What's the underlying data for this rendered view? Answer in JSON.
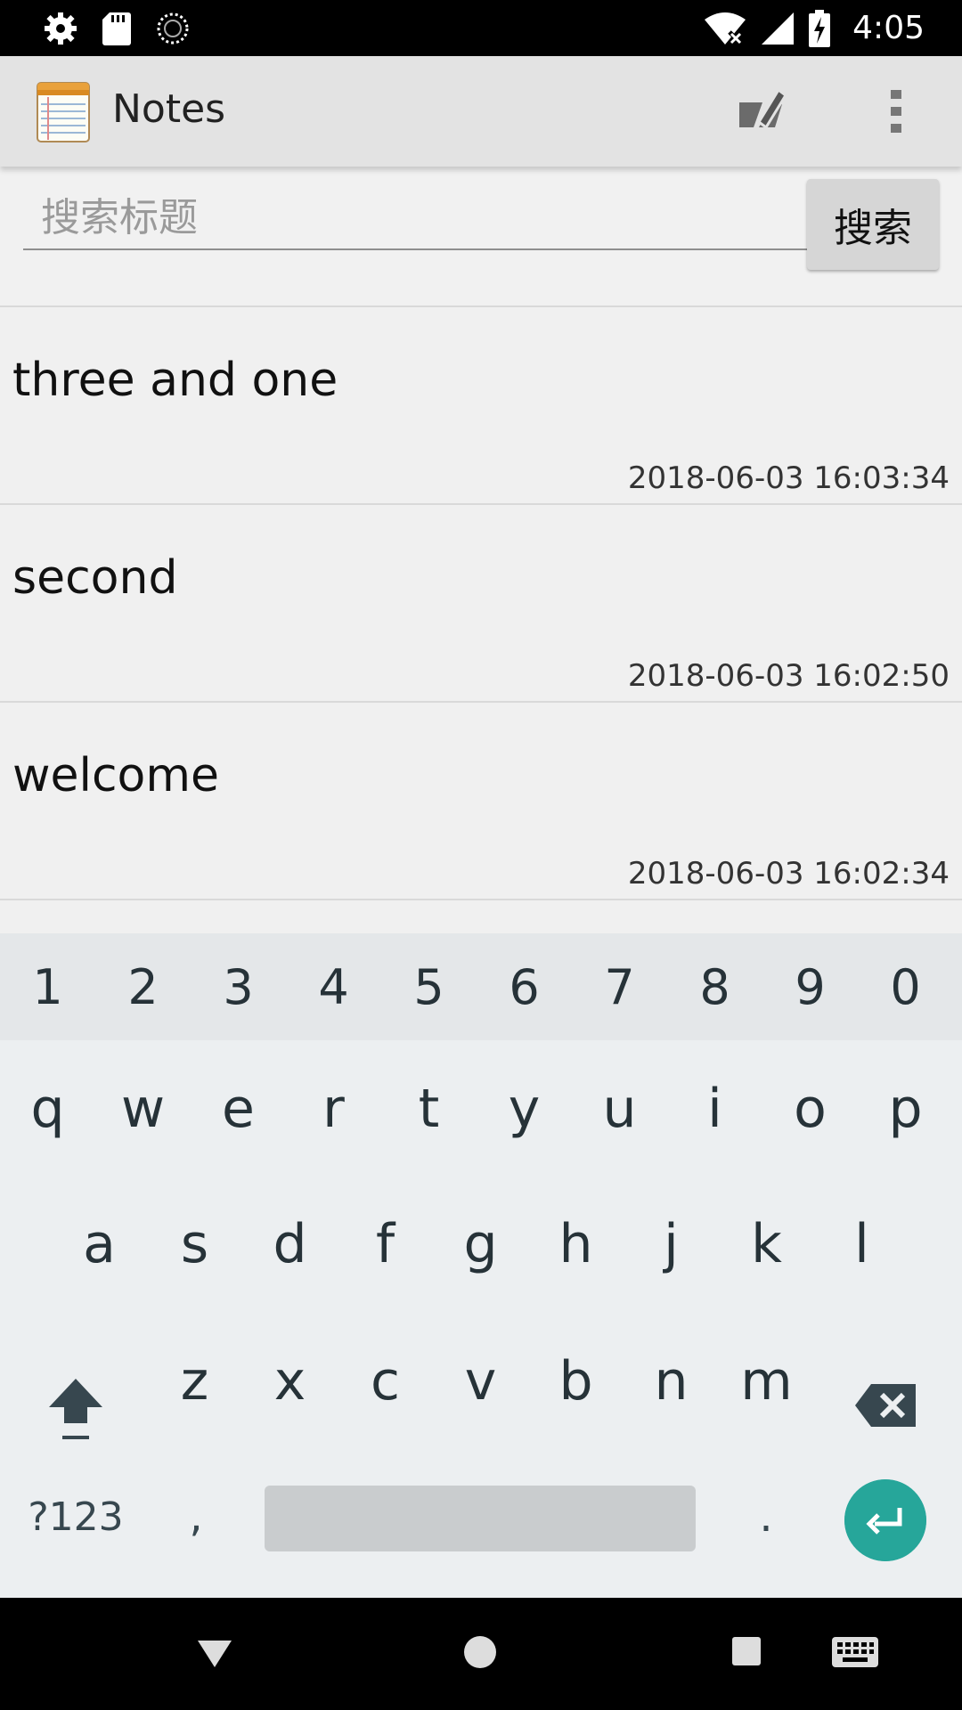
{
  "status_bar": {
    "time": "4:05",
    "icons": [
      "settings-icon",
      "sd-card-icon",
      "sync-icon",
      "wifi-off-icon",
      "signal-icon",
      "battery-charging-icon"
    ]
  },
  "app_bar": {
    "title": "Notes",
    "icons": [
      "notes-app-icon",
      "compose-icon",
      "overflow-menu-icon"
    ]
  },
  "search": {
    "placeholder": "搜索标题",
    "value": "",
    "button_label": "搜索"
  },
  "notes": [
    {
      "title": "three and one",
      "date": "2018-06-03 16:03:34"
    },
    {
      "title": "second",
      "date": "2018-06-03 16:02:50"
    },
    {
      "title": "welcome",
      "date": "2018-06-03 16:02:34"
    }
  ],
  "keyboard": {
    "numbers": [
      "1",
      "2",
      "3",
      "4",
      "5",
      "6",
      "7",
      "8",
      "9",
      "0"
    ],
    "row1": [
      "q",
      "w",
      "e",
      "r",
      "t",
      "y",
      "u",
      "i",
      "o",
      "p"
    ],
    "row2": [
      "a",
      "s",
      "d",
      "f",
      "g",
      "h",
      "j",
      "k",
      "l"
    ],
    "row3": [
      "z",
      "x",
      "c",
      "v",
      "b",
      "n",
      "m"
    ],
    "symbols_label": "?123",
    "comma": ",",
    "period": ".",
    "accent_color": "#26a69a"
  },
  "nav_bar": {
    "icons": [
      "back-icon",
      "home-icon",
      "recents-icon",
      "keyboard-switch-icon"
    ]
  }
}
